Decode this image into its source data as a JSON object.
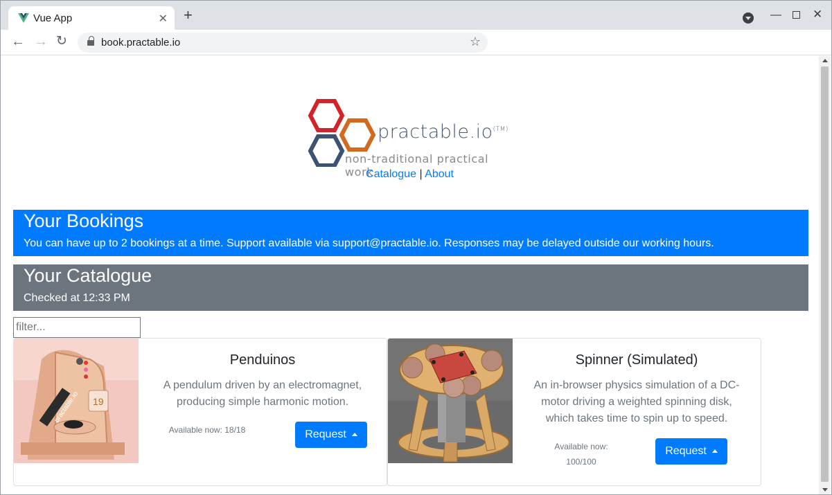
{
  "browser": {
    "tab_title": "Vue App",
    "url": "book.practable.io"
  },
  "logo": {
    "wordmark": "practable.io",
    "trademark": "(TM)",
    "tagline": "non-traditional practical work",
    "colors": {
      "red": "#d2232a",
      "orange": "#d2691e",
      "blue": "#3d5170"
    }
  },
  "nav": {
    "catalogue": "Catalogue",
    "separator": "|",
    "about": "About"
  },
  "bookings": {
    "title": "Your Bookings",
    "text": "You can have up to 2 bookings at a time. Support available via support@practable.io. Responses may be delayed outside our working hours."
  },
  "catalogue": {
    "title": "Your Catalogue",
    "checked": "Checked at 12:33 PM",
    "filter_placeholder": "filter...",
    "items": [
      {
        "title": "Penduinos",
        "description": "A pendulum driven by an electromagnet, producing simple harmonic motion.",
        "available_line1": "Available now: 18/18",
        "button": "Request",
        "image_label": "practable.io",
        "image_number": "19"
      },
      {
        "title": "Spinner (Simulated)",
        "description": "An in-browser physics simulation of a DC-motor driving a weighted spinning disk, which takes time to spin up to speed.",
        "available_line1": "Available now:",
        "available_line2": "100/100",
        "button": "Request"
      }
    ]
  },
  "colors": {
    "primary": "#007bff",
    "secondary": "#6c757d"
  }
}
